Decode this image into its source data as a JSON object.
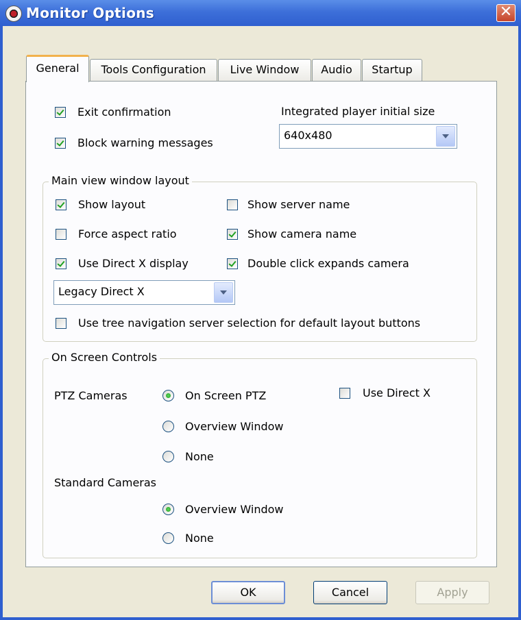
{
  "window": {
    "title": "Monitor Options",
    "close_symbol": "✕"
  },
  "tabs": [
    {
      "label": "General",
      "active": true
    },
    {
      "label": "Tools Configuration",
      "active": false
    },
    {
      "label": "Live Window",
      "active": false
    },
    {
      "label": "Audio",
      "active": false
    },
    {
      "label": "Startup",
      "active": false
    }
  ],
  "general": {
    "exit_confirmation": {
      "label": "Exit confirmation",
      "checked": true
    },
    "block_warning": {
      "label": "Block warning messages",
      "checked": true
    },
    "player_size": {
      "label": "Integrated player initial size",
      "value": "640x480"
    }
  },
  "layout_group": {
    "legend": "Main view window layout",
    "show_layout": {
      "label": "Show layout",
      "checked": true
    },
    "show_server_name": {
      "label": "Show server name",
      "checked": false
    },
    "force_aspect": {
      "label": "Force aspect ratio",
      "checked": false
    },
    "show_camera_name": {
      "label": "Show camera name",
      "checked": true
    },
    "use_directx_display": {
      "label": "Use Direct X display",
      "checked": true
    },
    "double_click_expands": {
      "label": "Double click expands camera",
      "checked": true
    },
    "directx_mode": {
      "value": "Legacy Direct X"
    },
    "tree_navigation": {
      "label": "Use tree navigation server selection for default layout buttons",
      "checked": false
    }
  },
  "osc_group": {
    "legend": "On Screen Controls",
    "ptz_label": "PTZ Cameras",
    "ptz_options": [
      {
        "label": "On Screen PTZ",
        "selected": true
      },
      {
        "label": "Overview Window",
        "selected": false
      },
      {
        "label": "None",
        "selected": false
      }
    ],
    "use_directx": {
      "label": "Use Direct X",
      "checked": false
    },
    "standard_label": "Standard Cameras",
    "standard_options": [
      {
        "label": "Overview Window",
        "selected": true
      },
      {
        "label": "None",
        "selected": false
      }
    ]
  },
  "buttons": {
    "ok": "OK",
    "cancel": "Cancel",
    "apply": "Apply",
    "apply_enabled": false
  },
  "colors": {
    "titlebar": "#3d6fd9",
    "check": "#21a121",
    "tab_highlight": "#f2b14c",
    "face": "#ece9d8"
  }
}
